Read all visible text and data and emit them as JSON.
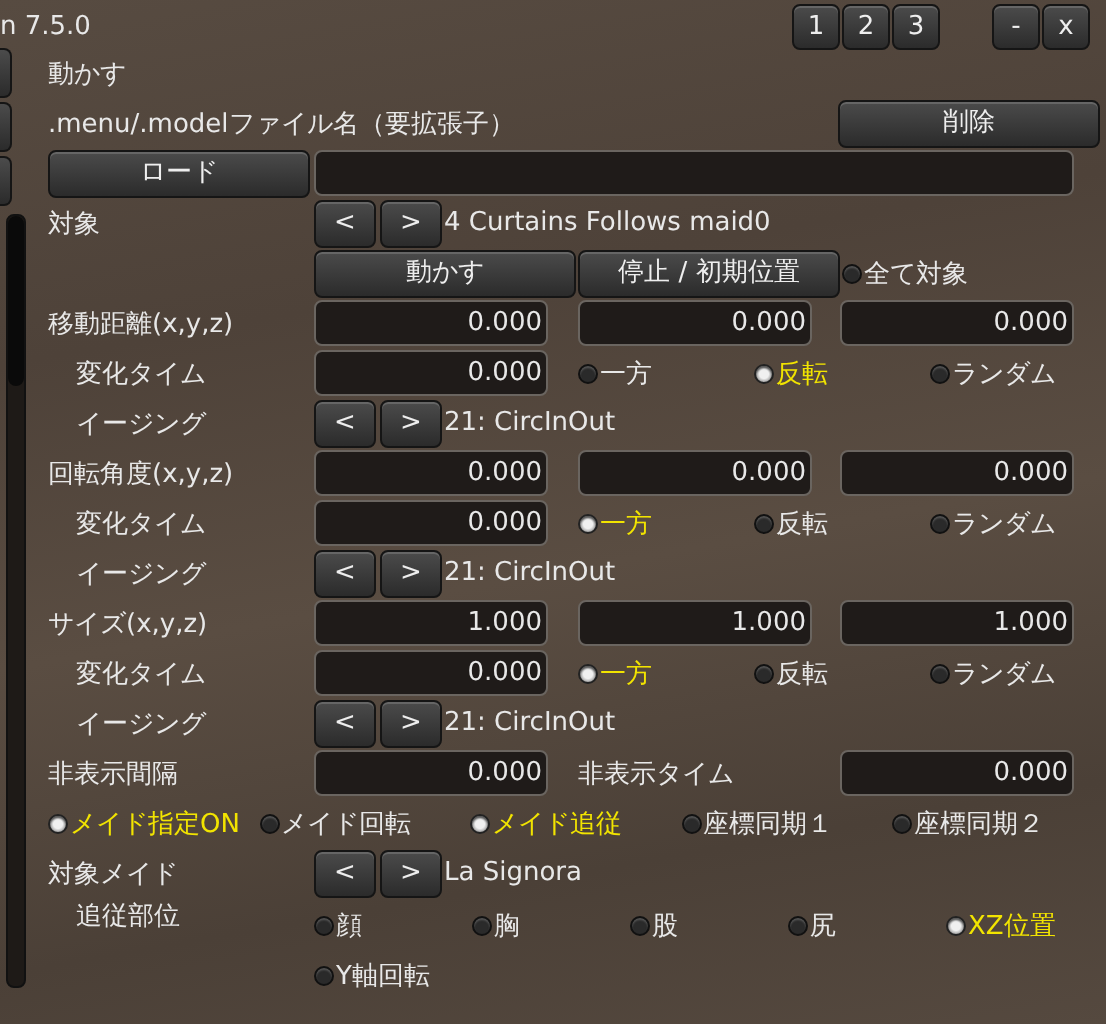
{
  "title": "n 7.5.0",
  "window_buttons": [
    "1",
    "2",
    "3",
    "-",
    "x"
  ],
  "rows": [
    {
      "kind": "heading",
      "label": "動かす"
    },
    {
      "kind": "label_button",
      "label": ".menu/.modelファイル名（要拡張子）",
      "button": "削除"
    },
    {
      "kind": "button_field",
      "button": "ロード"
    },
    {
      "kind": "selector",
      "label": "対象",
      "prev": "<",
      "next": ">",
      "value": "4 Curtains Follows maid0"
    },
    {
      "kind": "actions",
      "buttons": [
        "動かす",
        "停止 / 初期位置"
      ],
      "toggle": {
        "label": "全て対象",
        "selected": false
      }
    },
    {
      "kind": "vector",
      "label": "移動距離(x,y,z)",
      "values": [
        "0.000",
        "0.000",
        "0.000"
      ]
    },
    {
      "kind": "mode",
      "label": "変化タイム",
      "value": "0.000",
      "options": [
        {
          "label": "一方",
          "selected": false
        },
        {
          "label": "反転",
          "selected": true
        },
        {
          "label": "ランダム",
          "selected": false
        }
      ]
    },
    {
      "kind": "easing",
      "label": "イージング",
      "prev": "<",
      "next": ">",
      "value": "21: CircInOut"
    },
    {
      "kind": "vector",
      "label": "回転角度(x,y,z)",
      "values": [
        "0.000",
        "0.000",
        "0.000"
      ]
    },
    {
      "kind": "mode",
      "label": "変化タイム",
      "value": "0.000",
      "options": [
        {
          "label": "一方",
          "selected": true
        },
        {
          "label": "反転",
          "selected": false
        },
        {
          "label": "ランダム",
          "selected": false
        }
      ]
    },
    {
      "kind": "easing",
      "label": "イージング",
      "prev": "<",
      "next": ">",
      "value": "21: CircInOut"
    },
    {
      "kind": "vector",
      "label": "サイズ(x,y,z)",
      "values": [
        "1.000",
        "1.000",
        "1.000"
      ]
    },
    {
      "kind": "mode",
      "label": "変化タイム",
      "value": "0.000",
      "options": [
        {
          "label": "一方",
          "selected": true
        },
        {
          "label": "反転",
          "selected": false
        },
        {
          "label": "ランダム",
          "selected": false
        }
      ]
    },
    {
      "kind": "easing",
      "label": "イージング",
      "prev": "<",
      "next": ">",
      "value": "21: CircInOut"
    },
    {
      "kind": "pair",
      "label": "非表示間隔",
      "value": "0.000",
      "label2": "非表示タイム",
      "value2": "0.000"
    },
    {
      "kind": "toggles",
      "options": [
        {
          "label": "メイド指定ON",
          "selected": true
        },
        {
          "label": "メイド回転",
          "selected": false
        },
        {
          "label": "メイド追従",
          "selected": true
        },
        {
          "label": "座標同期１",
          "selected": false
        },
        {
          "label": "座標同期２",
          "selected": false
        }
      ]
    },
    {
      "kind": "selector",
      "label": "対象メイド",
      "prev": "<",
      "next": ">",
      "value": "La Signora"
    },
    {
      "kind": "parts",
      "label": "追従部位",
      "options": [
        {
          "label": "顔",
          "selected": false
        },
        {
          "label": "胸",
          "selected": false
        },
        {
          "label": "股",
          "selected": false
        },
        {
          "label": "尻",
          "selected": false
        },
        {
          "label": "XZ位置",
          "selected": true
        },
        {
          "label": "Y軸回転",
          "selected": false
        }
      ]
    }
  ]
}
